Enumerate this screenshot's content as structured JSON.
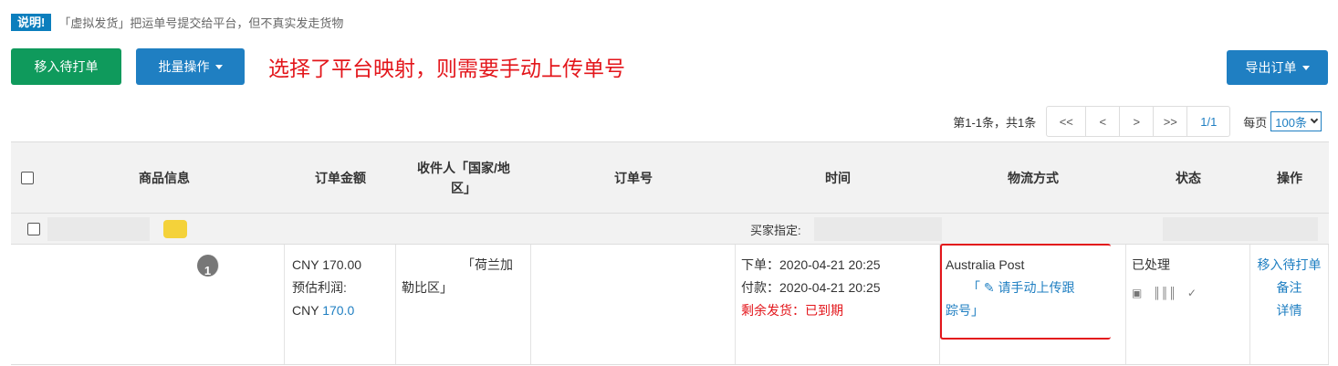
{
  "notice": {
    "tag": "说明!",
    "text": "「虚拟发货」把运单号提交给平台，但不真实发走货物"
  },
  "toolbar": {
    "move_to_print": "移入待打单",
    "batch_ops": "批量操作",
    "export_orders": "导出订单",
    "hint": "选择了平台映射，则需要手动上传单号"
  },
  "pager": {
    "summary": "第1-1条，共1条",
    "first": "<<",
    "prev": "<",
    "next": ">",
    "last": ">>",
    "page": "1/1",
    "per_page_label": "每页",
    "per_page_value": "100条"
  },
  "table": {
    "headers": {
      "product": "商品信息",
      "amount": "订单金额",
      "receiver_line1": "收件人「国家/地",
      "receiver_line2": "区」",
      "order_no": "订单号",
      "time": "时间",
      "logistics": "物流方式",
      "status": "状态",
      "actions": "操作"
    },
    "group": {
      "buyer_label": "买家指定:"
    },
    "row": {
      "qty": "1",
      "amount": "CNY 170.00",
      "profit_label": "预估利润:",
      "profit_currency": "CNY ",
      "profit_value": "170.0",
      "receiver_line1": "「荷兰加",
      "receiver_line2": "勒比区」",
      "order_time": "下单：2020-04-21 20:25",
      "pay_time": "付款：2020-04-21 20:25",
      "ship_remaining": "剩余发货：已到期",
      "carrier": "Australia Post",
      "upload_prefix": "「",
      "upload_link": "请手动上传跟",
      "upload_link2": "踪号",
      "upload_suffix": "」",
      "status": "已处理",
      "action_move": "移入待打单",
      "action_note": "备注",
      "action_detail": "详情"
    }
  },
  "colors": {
    "primary_blue": "#1f7fc2",
    "green": "#0f9a5c",
    "red": "#e3161b",
    "notice_tag": "#0b7ebd"
  }
}
